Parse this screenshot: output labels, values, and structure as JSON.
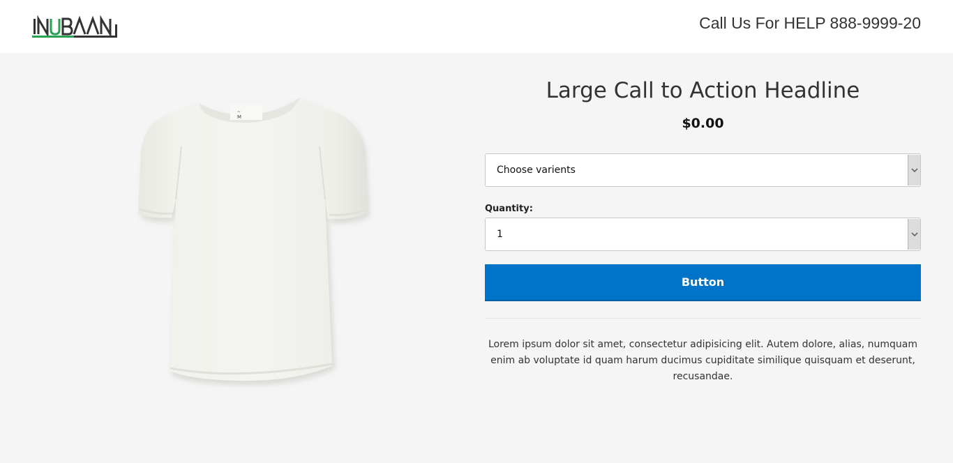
{
  "header": {
    "logo_text": "INUBAAN",
    "help_text": "Call Us For HELP 888-9999-20"
  },
  "product": {
    "image_icon": "tshirt-image",
    "headline": "Large Call to Action Headline",
    "price": "$0.00",
    "variant_select": {
      "value": "Choose varients"
    },
    "quantity": {
      "label": "Quantity:",
      "value": "1"
    },
    "button_label": "Button",
    "description": "Lorem ipsum dolor sit amet, consectetur adipisicing elit. Autem dolore, alias, numquam enim ab voluptate id quam harum ducimus cupiditate similique quisquam et deserunt, recusandae."
  },
  "colors": {
    "accent": "#0074c8",
    "logo_green": "#27a152",
    "logo_dark": "#333333",
    "background": "#f5f5f5"
  }
}
